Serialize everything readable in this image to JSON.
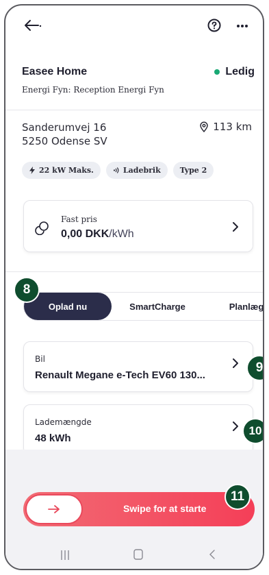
{
  "station": {
    "name": "Easee Home",
    "subtitle": "Energi Fyn: Reception Energi Fyn",
    "status": "Ledig",
    "status_color": "#19a974"
  },
  "address": {
    "line1": "Sanderumvej 16",
    "line2": "5250 Odense SV",
    "distance": "113 km"
  },
  "chips": [
    {
      "label": "22 kW Maks.",
      "icon": "bolt-icon"
    },
    {
      "label": "Ladebrik",
      "icon": "signal-icon"
    },
    {
      "label": "Type 2"
    }
  ],
  "price": {
    "label": "Fast pris",
    "value": "0,00 DKK",
    "unit": "/kWh",
    "icon": "coins-icon"
  },
  "tabs": [
    {
      "label": "Oplad nu",
      "active": true
    },
    {
      "label": "SmartCharge"
    },
    {
      "label": "Planlæg"
    }
  ],
  "car": {
    "label": "Bil",
    "value": "Renault Megane e-Tech EV60 130..."
  },
  "amount": {
    "label": "Lademængde",
    "value": "48 kWh"
  },
  "swipe": {
    "label": "Swipe for at starte"
  },
  "badges": {
    "b8": "8",
    "b9": "9",
    "b10": "10",
    "b11": "11"
  },
  "colors": {
    "accent_dark": "#2b2d4a",
    "swipe_red": "#f43f58",
    "badge_green": "#0f4d2e"
  }
}
